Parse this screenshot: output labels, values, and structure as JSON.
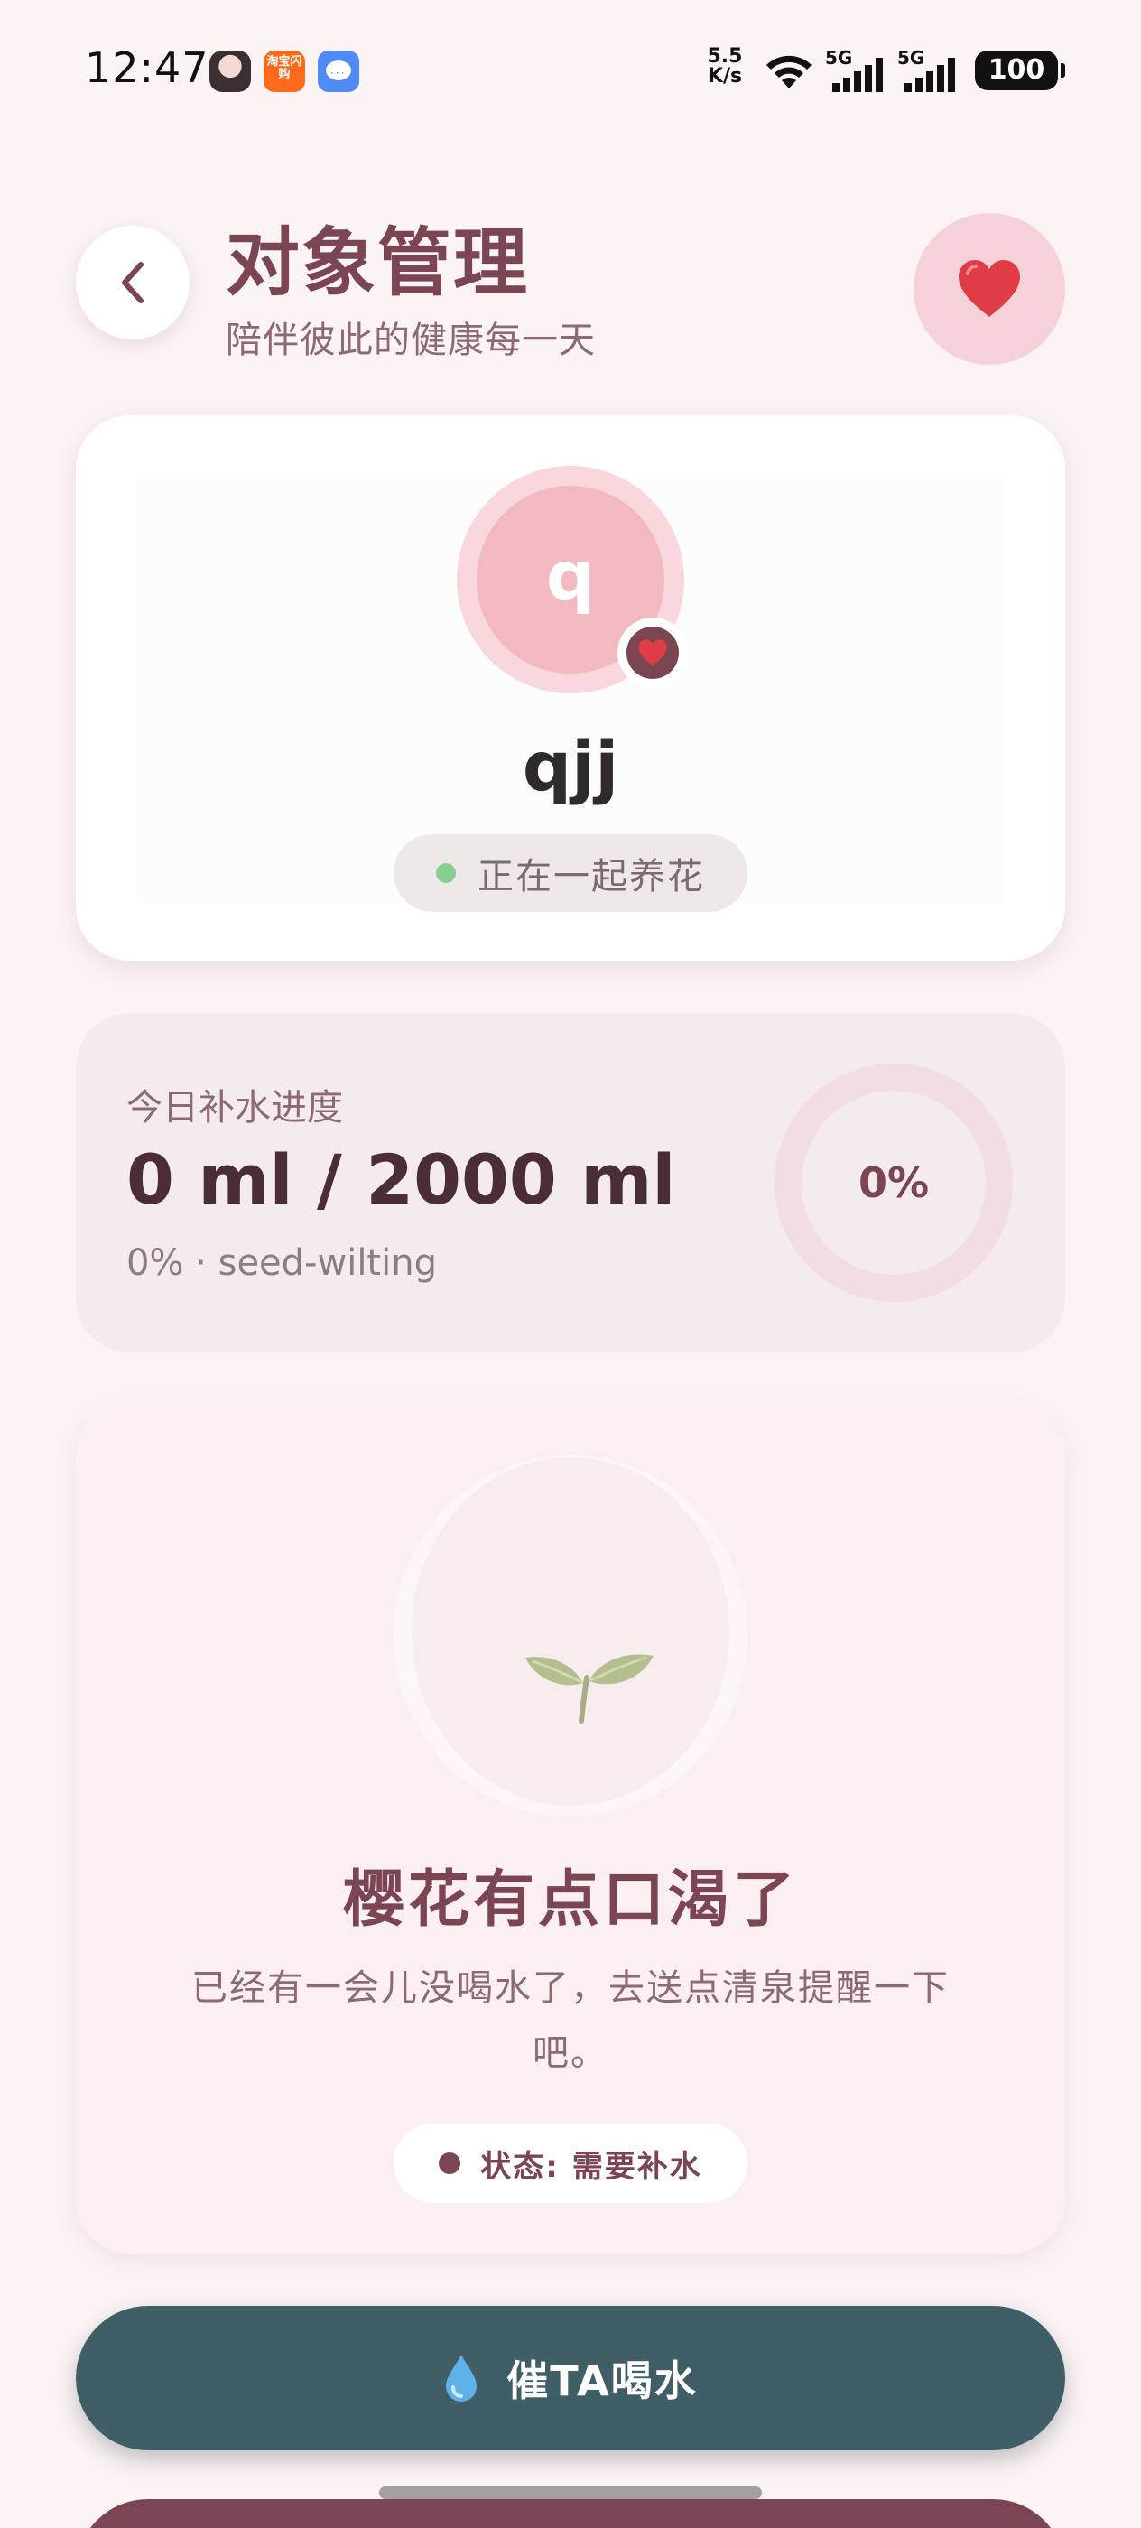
{
  "status_bar": {
    "time": "12:47",
    "app_taobao_label": "淘宝闪购",
    "net_speed_value": "5.5",
    "net_speed_unit": "K/s",
    "sim1_label": "5G",
    "sim2_label": "5G",
    "battery": "100"
  },
  "header": {
    "title": "对象管理",
    "subtitle": "陪伴彼此的健康每一天"
  },
  "profile": {
    "avatar_letter": "q",
    "name": "qjj",
    "status": "正在一起养花"
  },
  "progress": {
    "label": "今日补水进度",
    "amount": "0 ml / 2000 ml",
    "sub": "0% · seed-wilting",
    "percent_text": "0%",
    "percent_value": 0
  },
  "plant": {
    "title": "樱花有点口渴了",
    "description": "已经有一会儿没喝水了，去送点清泉提醒一下吧。",
    "state": "状态: 需要补水"
  },
  "actions": {
    "remind_label": "催TA喝水"
  },
  "colors": {
    "accent": "#7b4651",
    "primary_button": "#3f5e66",
    "heart": "#e03c45",
    "status_online": "#86d08f",
    "sprout": "#b5bf8e"
  },
  "icons": {
    "back": "chevron-left-icon",
    "favorite": "heart-icon",
    "badge": "heart-icon",
    "plant": "sprout-icon",
    "remind": "water-drop-icon"
  }
}
